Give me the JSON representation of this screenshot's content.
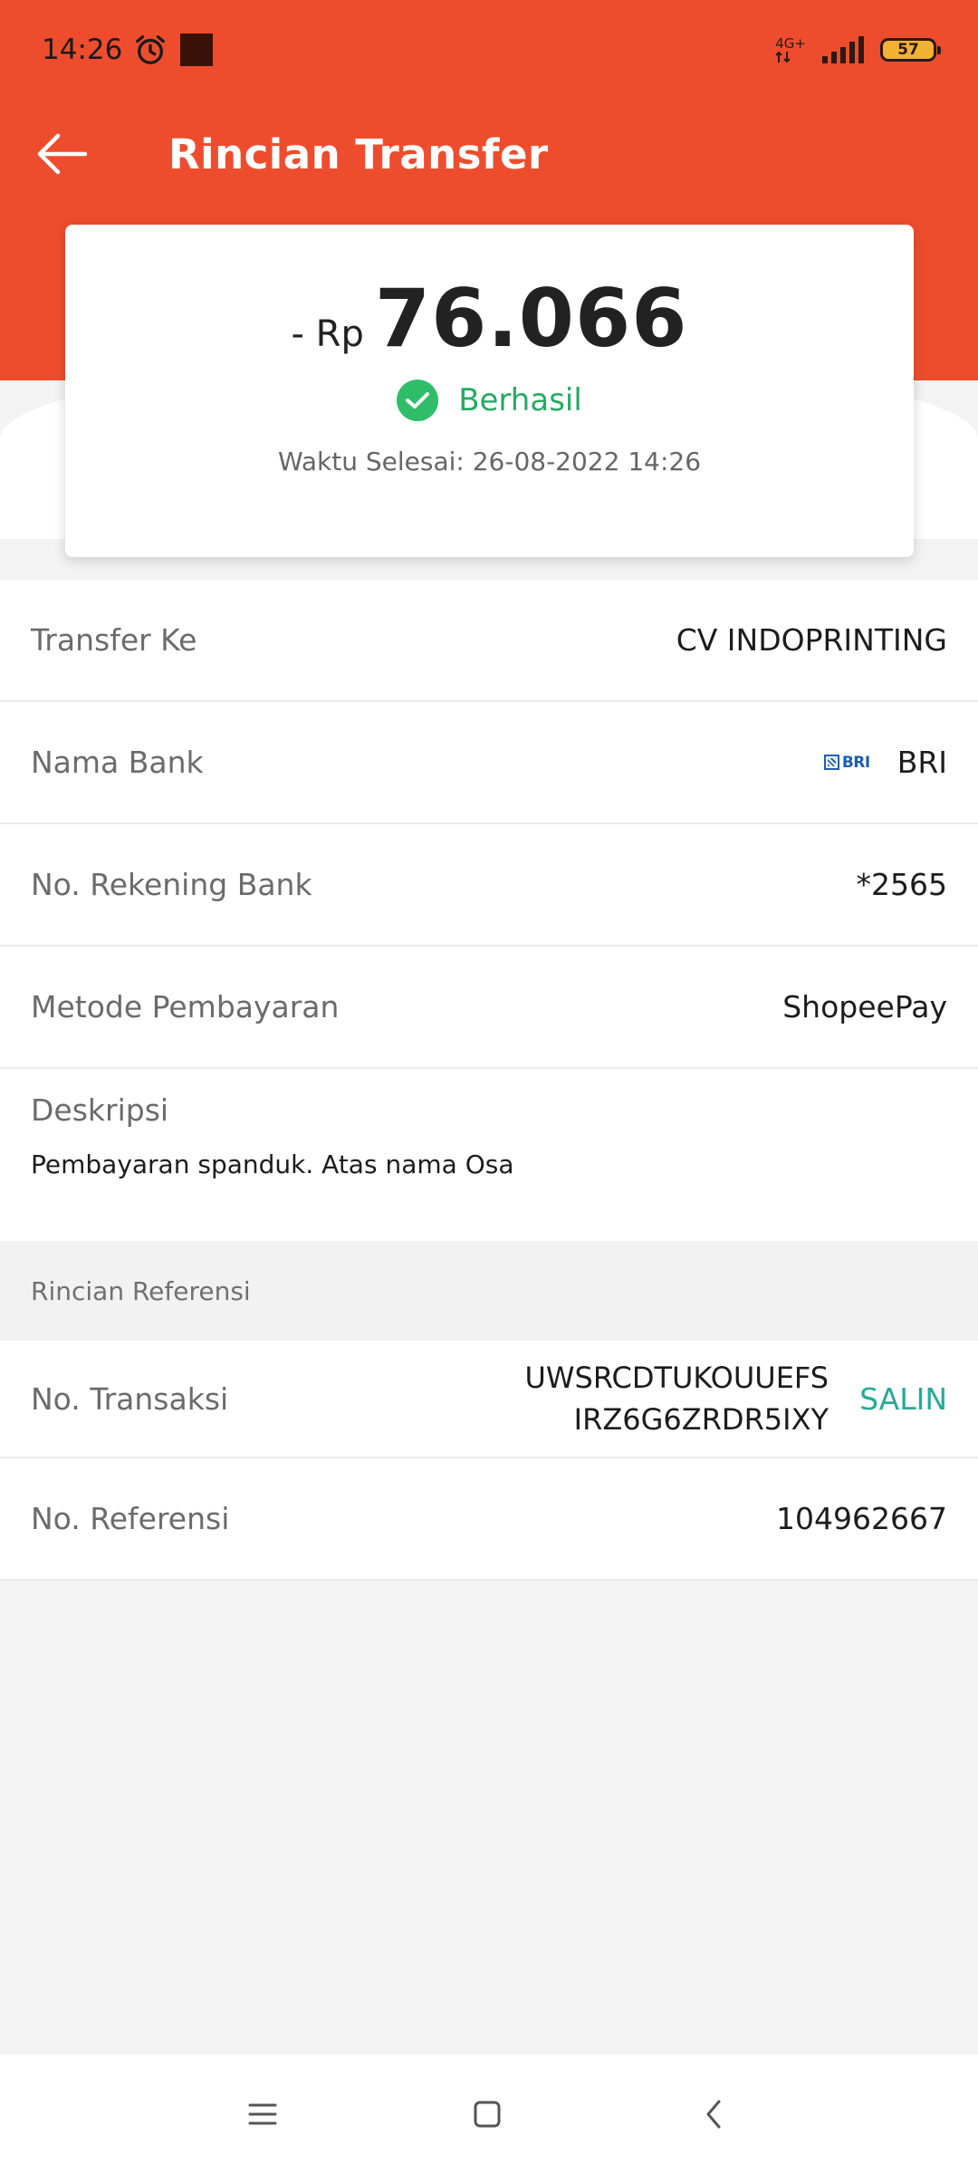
{
  "status_bar": {
    "time": "14:26",
    "network": "4G+",
    "battery": "57",
    "icons": [
      "alarm-icon",
      "notification-square-icon",
      "signal-icon",
      "battery-icon"
    ]
  },
  "app_bar": {
    "title": "Rincian Transfer",
    "back_icon": "arrow-left-icon"
  },
  "summary": {
    "prefix": "- Rp",
    "amount": "76.066",
    "status": "Berhasil",
    "status_color": "#2fbd69",
    "finish_time": "Waktu Selesai: 26-08-2022 14:26"
  },
  "details": {
    "transfer_to_label": "Transfer Ke",
    "transfer_to_value": "CV INDOPRINTING",
    "bank_label": "Nama Bank",
    "bank_logo_text": "BRI",
    "bank_value": "BRI",
    "account_label": "No. Rekening Bank",
    "account_value": "*2565",
    "method_label": "Metode Pembayaran",
    "method_value": "ShopeePay",
    "description_label": "Deskripsi",
    "description_value": "Pembayaran spanduk. Atas nama Osa"
  },
  "reference": {
    "section_title": "Rincian Referensi",
    "transaction_label": "No. Transaksi",
    "transaction_line1": "UWSRCDTUKOUUEFS",
    "transaction_line2": "IRZ6G6ZRDR5IXY",
    "copy_label": "SALIN",
    "reference_label": "No. Referensi",
    "reference_value": "104962667"
  },
  "colors": {
    "brand": "#ee4d2d",
    "success": "#26aa62",
    "copy": "#26aa99"
  },
  "nav_bar": {
    "buttons": [
      "menu-icon",
      "home-icon",
      "back-icon"
    ]
  }
}
